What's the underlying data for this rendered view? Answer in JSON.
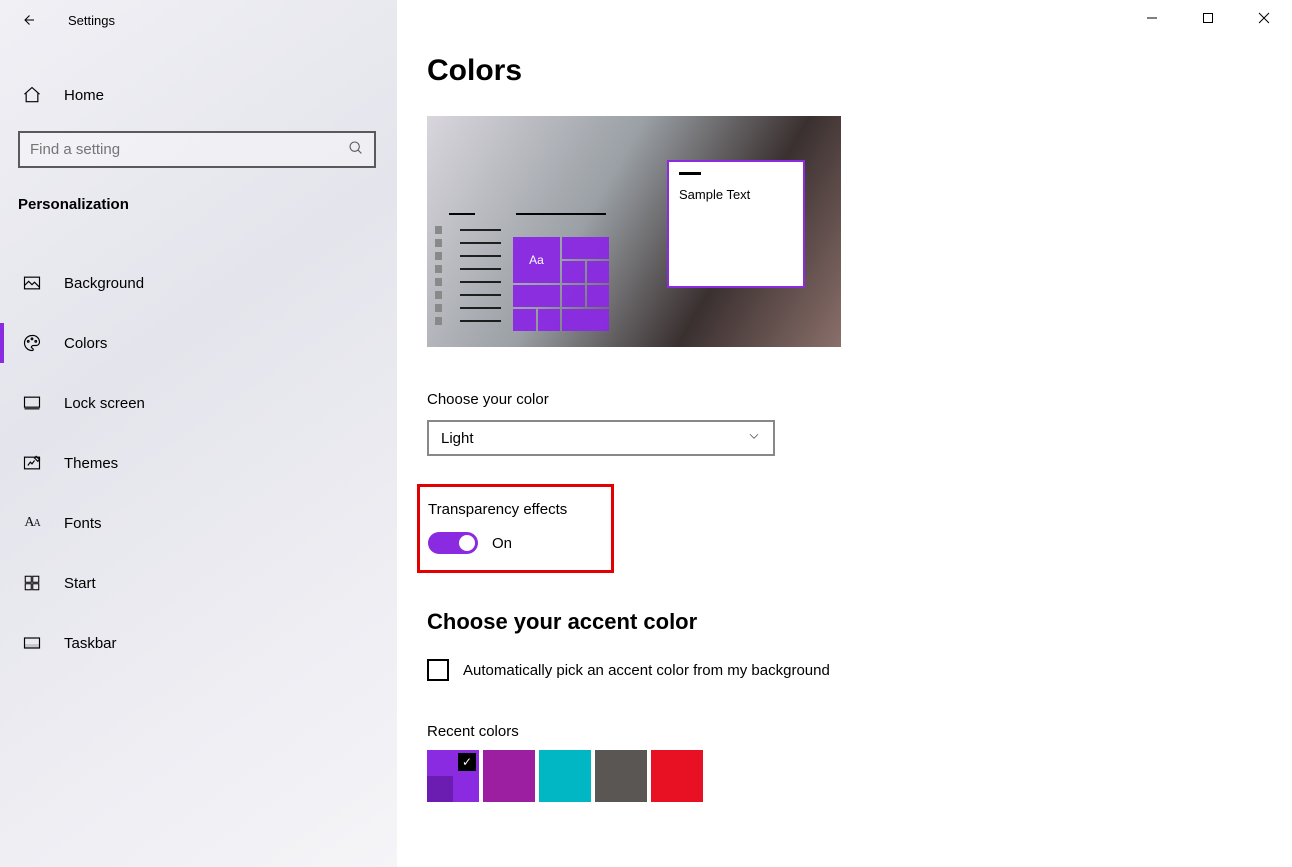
{
  "app": {
    "title": "Settings"
  },
  "sidebar": {
    "home_label": "Home",
    "search_placeholder": "Find a setting",
    "category": "Personalization",
    "items": [
      {
        "label": "Background"
      },
      {
        "label": "Colors"
      },
      {
        "label": "Lock screen"
      },
      {
        "label": "Themes"
      },
      {
        "label": "Fonts"
      },
      {
        "label": "Start"
      },
      {
        "label": "Taskbar"
      }
    ]
  },
  "main": {
    "title": "Colors",
    "preview_sample": "Sample Text",
    "preview_aa": "Aa",
    "choose_color_label": "Choose your color",
    "choose_color_value": "Light",
    "transparency_label": "Transparency effects",
    "transparency_state": "On",
    "accent_heading": "Choose your accent color",
    "auto_pick_label": "Automatically pick an accent color from my background",
    "recent_label": "Recent colors",
    "recent_colors": [
      "#8a2be2",
      "#9b1fa0",
      "#00b7c3",
      "#5a5654",
      "#e81123"
    ]
  }
}
